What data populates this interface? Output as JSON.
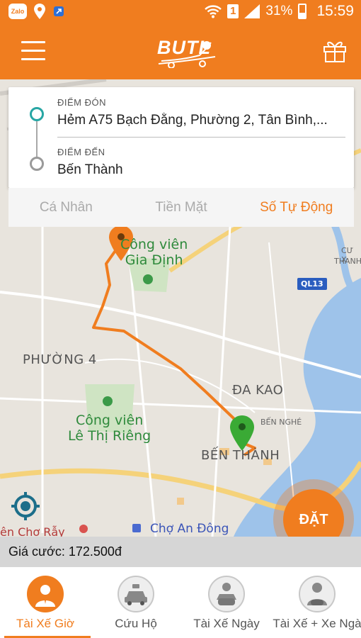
{
  "status_bar": {
    "app_icon": "Zalo",
    "sim": "1",
    "battery": "31%",
    "time": "15:59"
  },
  "app_bar": {
    "logo_text": "BUTL"
  },
  "trip": {
    "pickup_label": "ĐIỂM ĐÓN",
    "pickup_value": "Hẻm A75 Bạch Đằng, Phường 2, Tân Bình,...",
    "dropoff_label": "ĐIỂM ĐẾN",
    "dropoff_value": "Bến Thành"
  },
  "payment_tabs": [
    {
      "label": "Cá Nhân",
      "active": false
    },
    {
      "label": "Tiền Mặt",
      "active": false
    },
    {
      "label": "Số Tự Động",
      "active": true
    }
  ],
  "map": {
    "labels": {
      "park_gia_dinh": "Công viên\nGia Định",
      "phuong4": "PHƯỜNG 4",
      "park_le_thi_rieng": "Công viên\nLê Thị Riêng",
      "da_kao": "ĐA KAO",
      "ben_nghe": "BẾN NGHÉ",
      "ben_thanh": "BẾN THÀNH",
      "cu_xa": "CƯ X",
      "thanh": "THANH",
      "ql13": "QL13",
      "cho_an_dong": "Chợ An Đông",
      "cho_ray": "ện Chợ Rẫy"
    }
  },
  "book_button": "ĐẶT",
  "fare": "Giá cước: 172.500đ",
  "bottom_nav": [
    {
      "label": "Tài Xế Giờ",
      "active": true
    },
    {
      "label": "Cứu Hộ",
      "active": false
    },
    {
      "label": "Tài Xế Ngày",
      "active": false
    },
    {
      "label": "Tài Xế + Xe Ngà",
      "active": false
    }
  ],
  "colors": {
    "brand": "#f07d1f",
    "route": "#f07d1f",
    "pickup_dot": "#27a6a4",
    "destination_pin": "#3aaa35"
  }
}
